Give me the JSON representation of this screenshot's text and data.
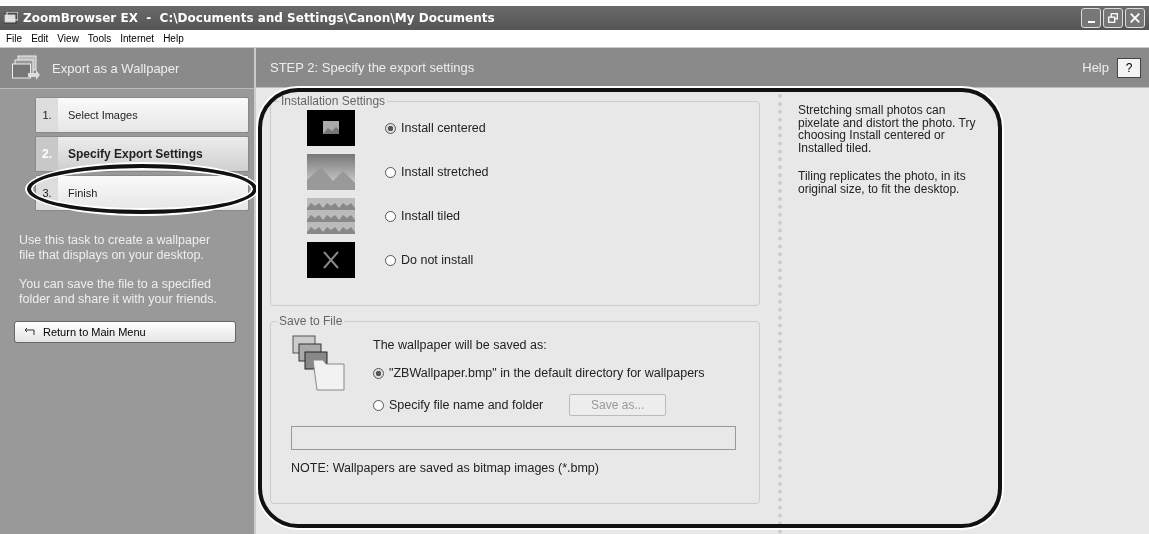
{
  "window": {
    "title": "ZoomBrowser EX  -  C:\\Documents and Settings\\Canon\\My Documents"
  },
  "menu": [
    "File",
    "Edit",
    "View",
    "Tools",
    "Internet",
    "Help"
  ],
  "task_header": {
    "title": "Export as a Wallpaper"
  },
  "step_header": {
    "title": "STEP 2: Specify the export settings",
    "help": "Help",
    "help_button": "?"
  },
  "steps": [
    {
      "number": "1.",
      "label": "Select Images",
      "selected": false
    },
    {
      "number": "2.",
      "label": "Specify Export Settings",
      "selected": true
    },
    {
      "number": "3.",
      "label": "Finish",
      "selected": false
    }
  ],
  "sidebar_text": [
    "Use this task to create a wallpaper file that displays on your desktop.",
    "You can save the file to a specified folder and share it with your friends."
  ],
  "return_button": "Return to Main Menu",
  "installation": {
    "title": "Installation Settings",
    "options": [
      {
        "kind": "centered",
        "label": "Install centered",
        "selected": true
      },
      {
        "kind": "stretched",
        "label": "Install stretched",
        "selected": false
      },
      {
        "kind": "tiled",
        "label": "Install tiled",
        "selected": false
      },
      {
        "kind": "none",
        "label": "Do not install",
        "selected": false
      }
    ]
  },
  "save": {
    "title": "Save to File",
    "intro": "The wallpaper will be saved as:",
    "options": [
      {
        "label": "\"ZBWallpaper.bmp\" in the default directory for wallpapers",
        "selected": true
      },
      {
        "label": "Specify file name and folder",
        "selected": false
      }
    ],
    "save_as": "Save as...",
    "note": "NOTE: Wallpapers are saved as bitmap images (*.bmp)"
  },
  "hint": [
    "Stretching small photos can pixelate and distort the photo. Try choosing Install centered or Installed tiled.",
    "Tiling replicates the photo, in its original size, to fit the desktop."
  ]
}
